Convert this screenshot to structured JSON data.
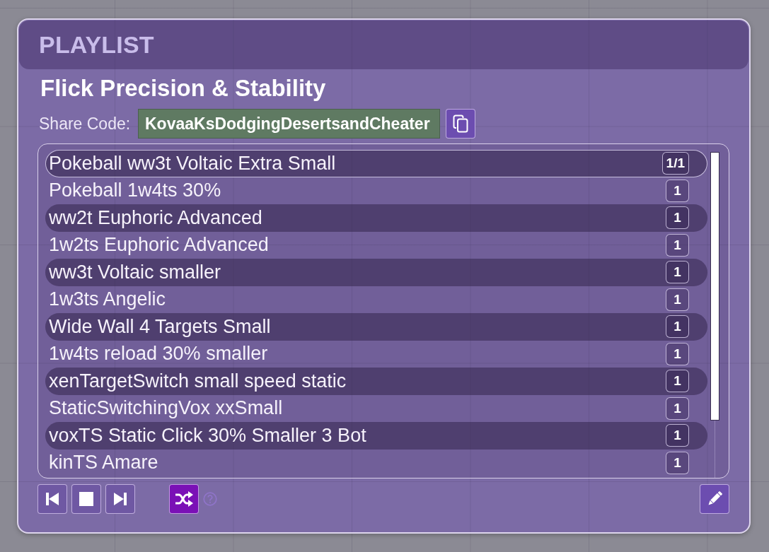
{
  "header": {
    "title": "PLAYLIST"
  },
  "playlist": {
    "name": "Flick Precision & Stability",
    "share_code": {
      "label": "Share Code:",
      "value": "KovaaKsDodgingDesertsandCheater"
    }
  },
  "scenarios": [
    {
      "name": "Pokeball ww3t Voltaic Extra Small",
      "count": "1/1",
      "selected": true
    },
    {
      "name": "Pokeball 1w4ts 30%",
      "count": "1",
      "selected": false
    },
    {
      "name": "ww2t Euphoric Advanced",
      "count": "1",
      "selected": false
    },
    {
      "name": "1w2ts Euphoric Advanced",
      "count": "1",
      "selected": false
    },
    {
      "name": "ww3t Voltaic smaller",
      "count": "1",
      "selected": false
    },
    {
      "name": "1w3ts Angelic",
      "count": "1",
      "selected": false
    },
    {
      "name": "Wide Wall 4 Targets Small",
      "count": "1",
      "selected": false
    },
    {
      "name": "1w4ts reload 30% smaller",
      "count": "1",
      "selected": false
    },
    {
      "name": "xenTargetSwitch small speed static",
      "count": "1",
      "selected": false
    },
    {
      "name": "StaticSwitchingVox xxSmall",
      "count": "1",
      "selected": false
    },
    {
      "name": "voxTS Static Click 30% Smaller 3 Bot",
      "count": "1",
      "selected": false
    },
    {
      "name": "kinTS Amare",
      "count": "1",
      "selected": false
    }
  ],
  "controls": {
    "shuffle": {
      "on": true
    }
  }
}
